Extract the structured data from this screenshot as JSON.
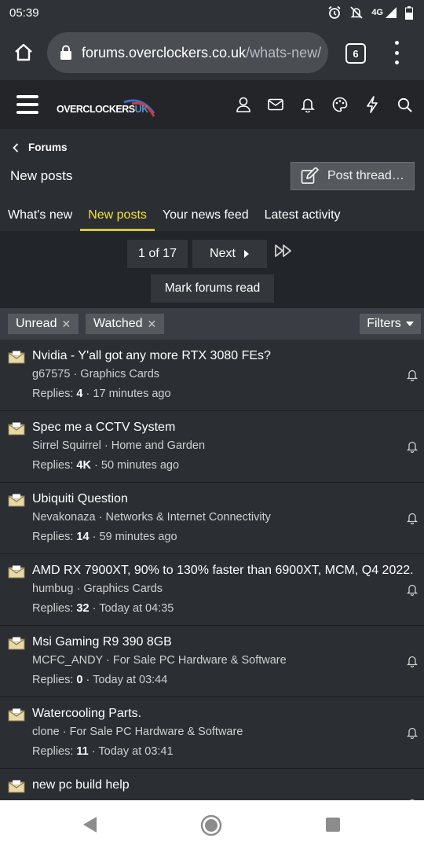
{
  "status_bar": {
    "time": "05:39",
    "network": "4G"
  },
  "browser": {
    "url_host": "forums.overclockers.co.uk",
    "url_path": "/whats-new/",
    "tab_count": "6"
  },
  "site": {
    "logo_main": "OVERCLOCKERS",
    "logo_suffix": "UK"
  },
  "breadcrumb": {
    "parent": "Forums"
  },
  "page": {
    "title": "New posts",
    "post_thread_label": "Post thread…"
  },
  "nav_tabs": [
    {
      "label": "What's new"
    },
    {
      "label": "New posts"
    },
    {
      "label": "Your news feed"
    },
    {
      "label": "Latest activity"
    }
  ],
  "pager": {
    "current": "1 of 17",
    "next_label": "Next",
    "mark_read_label": "Mark forums read"
  },
  "filters": {
    "chips": [
      {
        "label": "Unread"
      },
      {
        "label": "Watched"
      }
    ],
    "filters_label": "Filters"
  },
  "threads": [
    {
      "title": "Nvidia - Y'all got any more RTX 3080 FEs?",
      "author": "g67575",
      "forum": "Graphics Cards",
      "replies_label": "Replies:",
      "replies": "4",
      "time": "17 minutes ago"
    },
    {
      "title": "Spec me a CCTV System",
      "author": "Sirrel Squirrel",
      "forum": "Home and Garden",
      "replies_label": "Replies:",
      "replies": "4K",
      "time": "50 minutes ago"
    },
    {
      "title": "Ubiquiti Question",
      "author": "Nevakonaza",
      "forum": "Networks & Internet Connectivity",
      "replies_label": "Replies:",
      "replies": "14",
      "time": "59 minutes ago"
    },
    {
      "title": "AMD RX 7900XT, 90% to 130% faster than 6900XT, MCM, Q4 2022.",
      "author": "humbug",
      "forum": "Graphics Cards",
      "replies_label": "Replies:",
      "replies": "32",
      "time": "Today at 04:35"
    },
    {
      "title": "Msi Gaming R9 390 8GB",
      "author": "MCFC_ANDY",
      "forum": "For Sale PC Hardware & Software",
      "replies_label": "Replies:",
      "replies": "0",
      "time": "Today at 03:44"
    },
    {
      "title": "Watercooling Parts.",
      "author": "clone",
      "forum": "For Sale PC Hardware & Software",
      "replies_label": "Replies:",
      "replies": "11",
      "time": "Today at 03:41"
    },
    {
      "title": "new pc build help",
      "author": "",
      "forum": "",
      "replies_label": "",
      "replies": "",
      "time": ""
    }
  ],
  "separator": "·",
  "colors": {
    "active_tab": "#f3e23e",
    "header_bg": "#232528",
    "page_bg": "#2b2e33"
  }
}
